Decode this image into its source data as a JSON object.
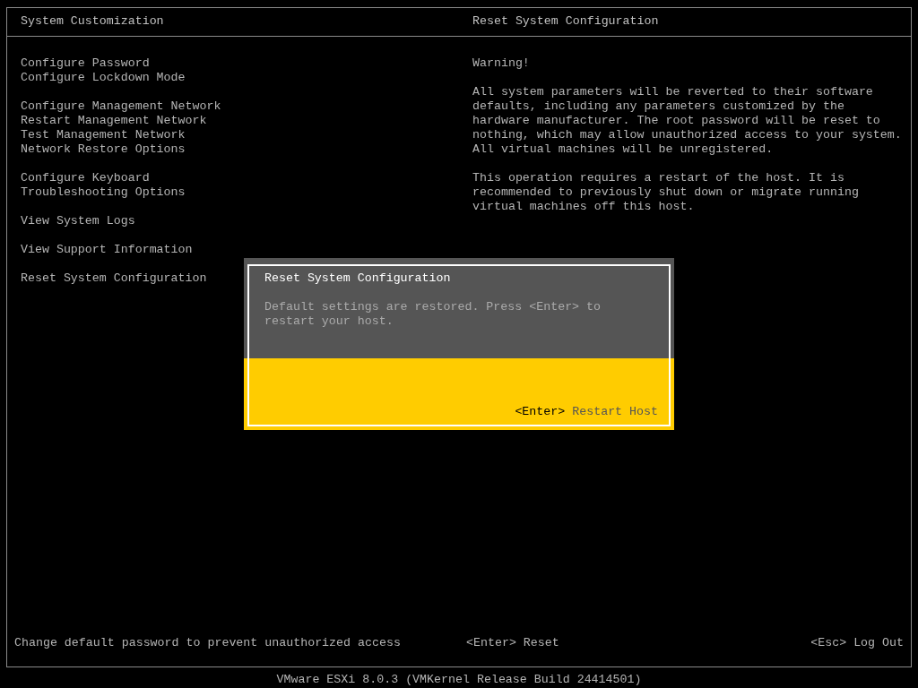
{
  "header": {
    "left_title": "System Customization",
    "right_title": "Reset System Configuration"
  },
  "menu_groups": [
    {
      "items": [
        {
          "label": "Configure Password"
        },
        {
          "label": "Configure Lockdown Mode"
        }
      ]
    },
    {
      "items": [
        {
          "label": "Configure Management Network"
        },
        {
          "label": "Restart Management Network"
        },
        {
          "label": "Test Management Network"
        },
        {
          "label": "Network Restore Options"
        }
      ]
    },
    {
      "items": [
        {
          "label": "Configure Keyboard"
        },
        {
          "label": "Troubleshooting Options"
        }
      ]
    },
    {
      "items": [
        {
          "label": "View System Logs"
        }
      ]
    },
    {
      "items": [
        {
          "label": "View Support Information"
        }
      ]
    },
    {
      "items": [
        {
          "label": "Reset System Configuration"
        }
      ]
    }
  ],
  "details": [
    {
      "text": "Warning!"
    },
    {
      "text": "All system parameters will be reverted to their software defaults, including any parameters customized by the hardware manufacturer. The root password will be reset to nothing, which may allow unauthorized access to your system. All virtual machines will be unregistered."
    },
    {
      "text": "This operation requires a restart of the host. It is recommended to previously shut down or migrate running virtual machines off this host."
    }
  ],
  "dialog": {
    "title": "Reset System Configuration",
    "message": "Default settings are restored. Press <Enter> to restart your host.",
    "action": {
      "key": "<Enter>",
      "label": "Restart Host"
    }
  },
  "footer": {
    "hint": "Change default password to prevent unauthorized access",
    "center_action": "<Enter> Reset",
    "right_action": "<Esc> Log Out"
  },
  "status_bar": "VMware ESXi 8.0.3 (VMKernel Release Build 24414501)"
}
